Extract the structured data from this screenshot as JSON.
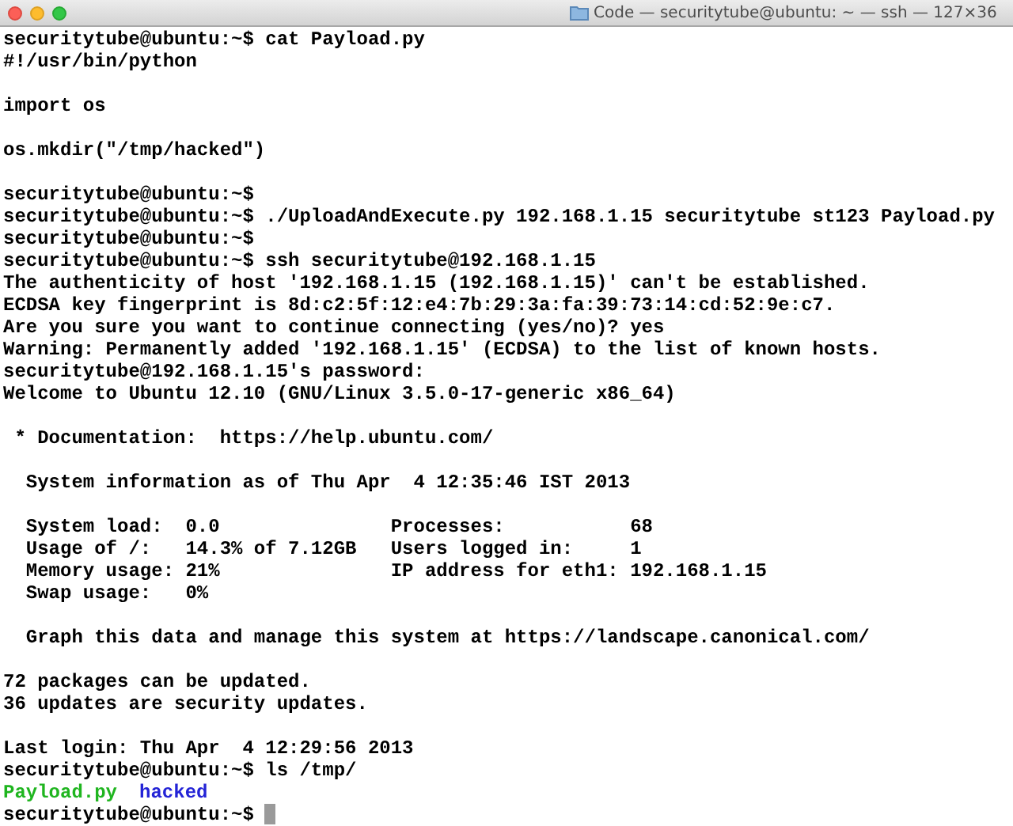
{
  "window": {
    "title": "Code — securitytube@ubuntu: ~ — ssh — 127×36"
  },
  "lines": [
    {
      "kind": "text",
      "text": "securitytube@ubuntu:~$ cat Payload.py"
    },
    {
      "kind": "text",
      "text": "#!/usr/bin/python"
    },
    {
      "kind": "blank"
    },
    {
      "kind": "text",
      "text": "import os"
    },
    {
      "kind": "blank"
    },
    {
      "kind": "text",
      "text": "os.mkdir(\"/tmp/hacked\")"
    },
    {
      "kind": "blank"
    },
    {
      "kind": "text",
      "text": "securitytube@ubuntu:~$"
    },
    {
      "kind": "text",
      "text": "securitytube@ubuntu:~$ ./UploadAndExecute.py 192.168.1.15 securitytube st123 Payload.py"
    },
    {
      "kind": "text",
      "text": "securitytube@ubuntu:~$"
    },
    {
      "kind": "text",
      "text": "securitytube@ubuntu:~$ ssh securitytube@192.168.1.15"
    },
    {
      "kind": "text",
      "text": "The authenticity of host '192.168.1.15 (192.168.1.15)' can't be established."
    },
    {
      "kind": "text",
      "text": "ECDSA key fingerprint is 8d:c2:5f:12:e4:7b:29:3a:fa:39:73:14:cd:52:9e:c7."
    },
    {
      "kind": "text",
      "text": "Are you sure you want to continue connecting (yes/no)? yes"
    },
    {
      "kind": "text",
      "text": "Warning: Permanently added '192.168.1.15' (ECDSA) to the list of known hosts."
    },
    {
      "kind": "text",
      "text": "securitytube@192.168.1.15's password:"
    },
    {
      "kind": "text",
      "text": "Welcome to Ubuntu 12.10 (GNU/Linux 3.5.0-17-generic x86_64)"
    },
    {
      "kind": "blank"
    },
    {
      "kind": "text",
      "text": " * Documentation:  https://help.ubuntu.com/"
    },
    {
      "kind": "blank"
    },
    {
      "kind": "text",
      "text": "  System information as of Thu Apr  4 12:35:46 IST 2013"
    },
    {
      "kind": "blank"
    },
    {
      "kind": "text",
      "text": "  System load:  0.0               Processes:           68"
    },
    {
      "kind": "text",
      "text": "  Usage of /:   14.3% of 7.12GB   Users logged in:     1"
    },
    {
      "kind": "text",
      "text": "  Memory usage: 21%               IP address for eth1: 192.168.1.15"
    },
    {
      "kind": "text",
      "text": "  Swap usage:   0%"
    },
    {
      "kind": "blank"
    },
    {
      "kind": "text",
      "text": "  Graph this data and manage this system at https://landscape.canonical.com/"
    },
    {
      "kind": "blank"
    },
    {
      "kind": "text",
      "text": "72 packages can be updated."
    },
    {
      "kind": "text",
      "text": "36 updates are security updates."
    },
    {
      "kind": "blank"
    },
    {
      "kind": "text",
      "text": "Last login: Thu Apr  4 12:29:56 2013"
    },
    {
      "kind": "text",
      "text": "securitytube@ubuntu:~$ ls /tmp/"
    },
    {
      "kind": "listing",
      "entries": [
        {
          "text": "Payload.py",
          "color": "#1fb51f"
        },
        {
          "text": "hacked",
          "color": "#2323d6"
        }
      ]
    },
    {
      "kind": "prompt",
      "text": "securitytube@ubuntu:~$"
    }
  ]
}
